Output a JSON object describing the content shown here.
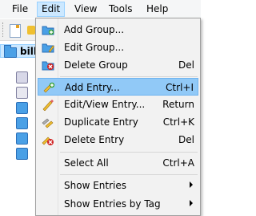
{
  "menubar": {
    "file": "File",
    "edit": "Edit",
    "view": "View",
    "tools": "Tools",
    "help": "Help"
  },
  "tree": {
    "root_label": "bill"
  },
  "edit_menu": {
    "items": [
      {
        "label": "Add Group...",
        "shortcut": "",
        "icon": "add-group-icon",
        "highlighted": false
      },
      {
        "label": "Edit Group...",
        "shortcut": "",
        "icon": "edit-group-icon",
        "highlighted": false
      },
      {
        "label": "Delete Group",
        "shortcut": "Del",
        "icon": "delete-group-icon",
        "highlighted": false
      },
      {
        "label": "Add Entry...",
        "shortcut": "Ctrl+I",
        "icon": "add-entry-icon",
        "highlighted": true
      },
      {
        "label": "Edit/View Entry...",
        "shortcut": "Return",
        "icon": "edit-entry-icon",
        "highlighted": false
      },
      {
        "label": "Duplicate Entry",
        "shortcut": "Ctrl+K",
        "icon": "duplicate-entry-icon",
        "highlighted": false
      },
      {
        "label": "Delete Entry",
        "shortcut": "Del",
        "icon": "delete-entry-icon",
        "highlighted": false
      },
      {
        "label": "Select All",
        "shortcut": "Ctrl+A",
        "icon": "",
        "highlighted": false
      },
      {
        "label": "Show Entries",
        "shortcut": "",
        "icon": "",
        "highlighted": false,
        "submenu": true
      },
      {
        "label": "Show Entries by Tag",
        "shortcut": "",
        "icon": "",
        "highlighted": false,
        "submenu": true
      }
    ]
  },
  "colors": {
    "highlight": "#91c9f7",
    "menubar_active": "#cce8ff"
  }
}
